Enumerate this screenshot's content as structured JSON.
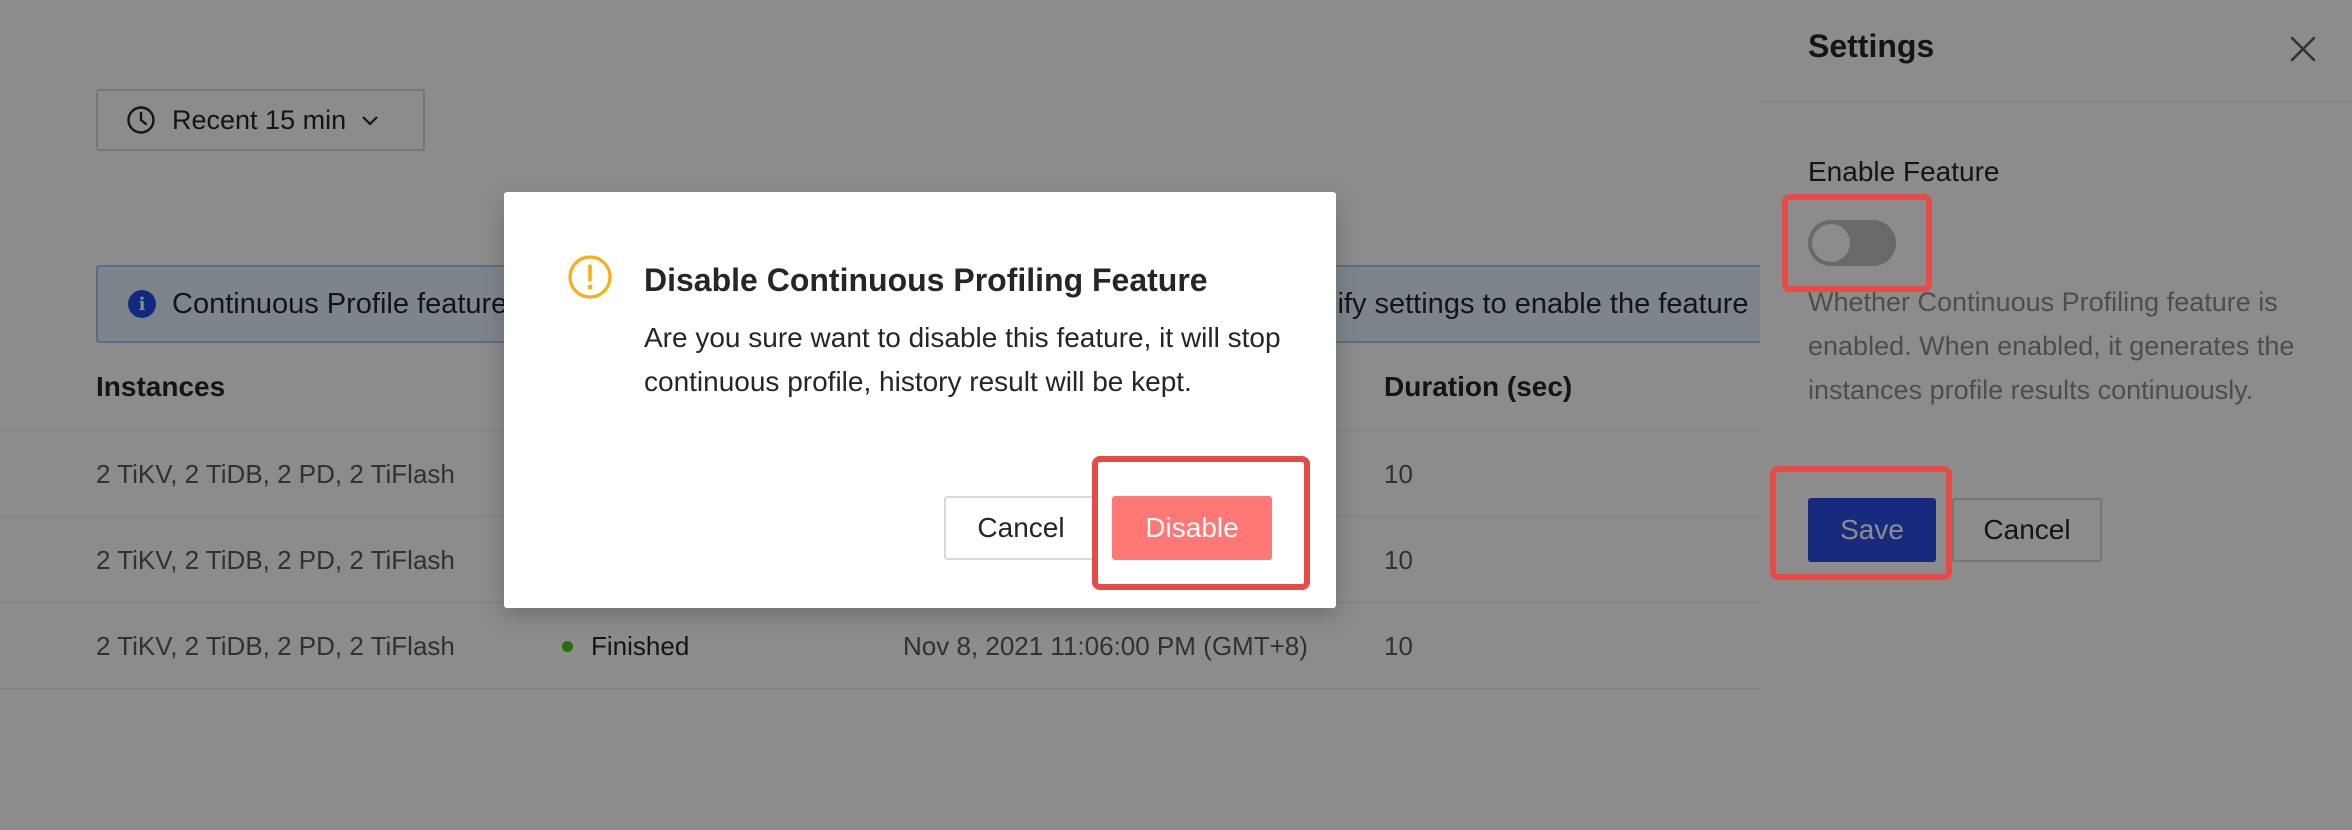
{
  "time_picker": {
    "label": "Recent 15 min"
  },
  "info_banner": {
    "text_left": "Continuous Profile feature",
    "text_right": "lify settings to enable the feature"
  },
  "table": {
    "headers": {
      "instances": "Instances",
      "duration": "Duration (sec)"
    },
    "rows": [
      {
        "instances": "2 TiKV, 2 TiDB, 2 PD, 2 TiFlash",
        "status": "",
        "time": "",
        "duration": "10"
      },
      {
        "instances": "2 TiKV, 2 TiDB, 2 PD, 2 TiFlash",
        "status": "",
        "time": "",
        "duration": "10"
      },
      {
        "instances": "2 TiKV, 2 TiDB, 2 PD, 2 TiFlash",
        "status": "Finished",
        "time": "Nov 8, 2021 11:06:00 PM (GMT+8)",
        "duration": "10"
      }
    ],
    "status_color": "#52c41a"
  },
  "drawer": {
    "title": "Settings",
    "field_label": "Enable Feature",
    "switch_on": false,
    "help_text": "Whether Continuous Profiling feature is enabled. When enabled, it generates the instances profile results continuously.",
    "save_label": "Save",
    "cancel_label": "Cancel"
  },
  "modal": {
    "title": "Disable Continuous Profiling Feature",
    "content": "Are you sure want to disable this feature, it will stop continuous profile, history result will be kept.",
    "cancel_label": "Cancel",
    "disable_label": "Disable",
    "icon": "exclamation-circle-icon"
  },
  "colors": {
    "primary": "#2c4de6",
    "danger": "#ff7875",
    "warning": "#faad14",
    "highlight": "#e84a48"
  }
}
